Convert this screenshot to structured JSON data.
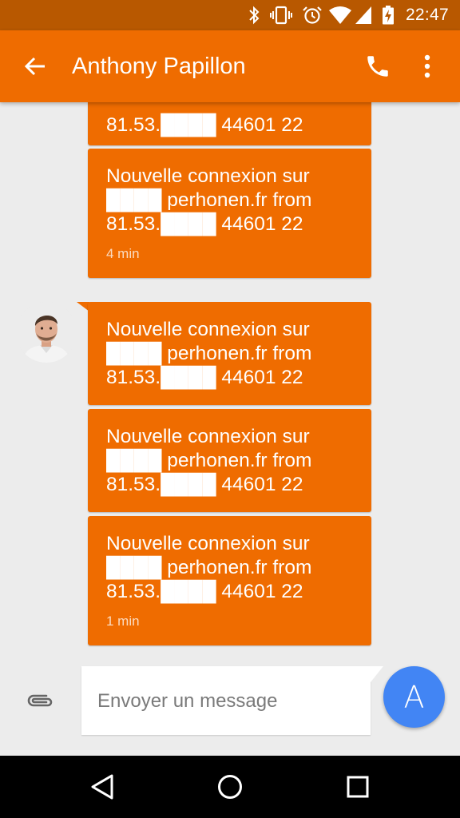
{
  "status_bar": {
    "time": "22:47",
    "icons": [
      "bluetooth-icon",
      "vibrate-icon",
      "alarm-icon",
      "wifi-icon",
      "signal-icon",
      "battery-charging-icon"
    ]
  },
  "app_bar": {
    "title": "Anthony Papillon",
    "icons": [
      "back-arrow-icon",
      "phone-icon",
      "more-vert-icon"
    ]
  },
  "messages": [
    {
      "text": "81.53.████ 44601 22",
      "time": ""
    },
    {
      "text": "Nouvelle connexion sur\n████ perhonen.fr from\n81.53.████ 44601 22",
      "time": "4 min"
    },
    {
      "text": "Nouvelle connexion sur\n████ perhonen.fr from\n81.53.████ 44601 22",
      "time": ""
    },
    {
      "text": "Nouvelle connexion sur\n████ perhonen.fr from\n81.53.████ 44601 22",
      "time": ""
    },
    {
      "text": "Nouvelle connexion sur\n████ perhonen.fr from\n81.53.████ 44601 22",
      "time": "1 min"
    }
  ],
  "compose": {
    "placeholder": "Envoyer un message",
    "send_label": "A"
  },
  "nav_bar": {
    "icons": [
      "nav-back-icon",
      "nav-home-icon",
      "nav-recents-icon"
    ]
  },
  "colors": {
    "accent": "#ef6c00",
    "status_bar": "#b85800",
    "send_button": "#4285f4",
    "background": "#ececec"
  }
}
